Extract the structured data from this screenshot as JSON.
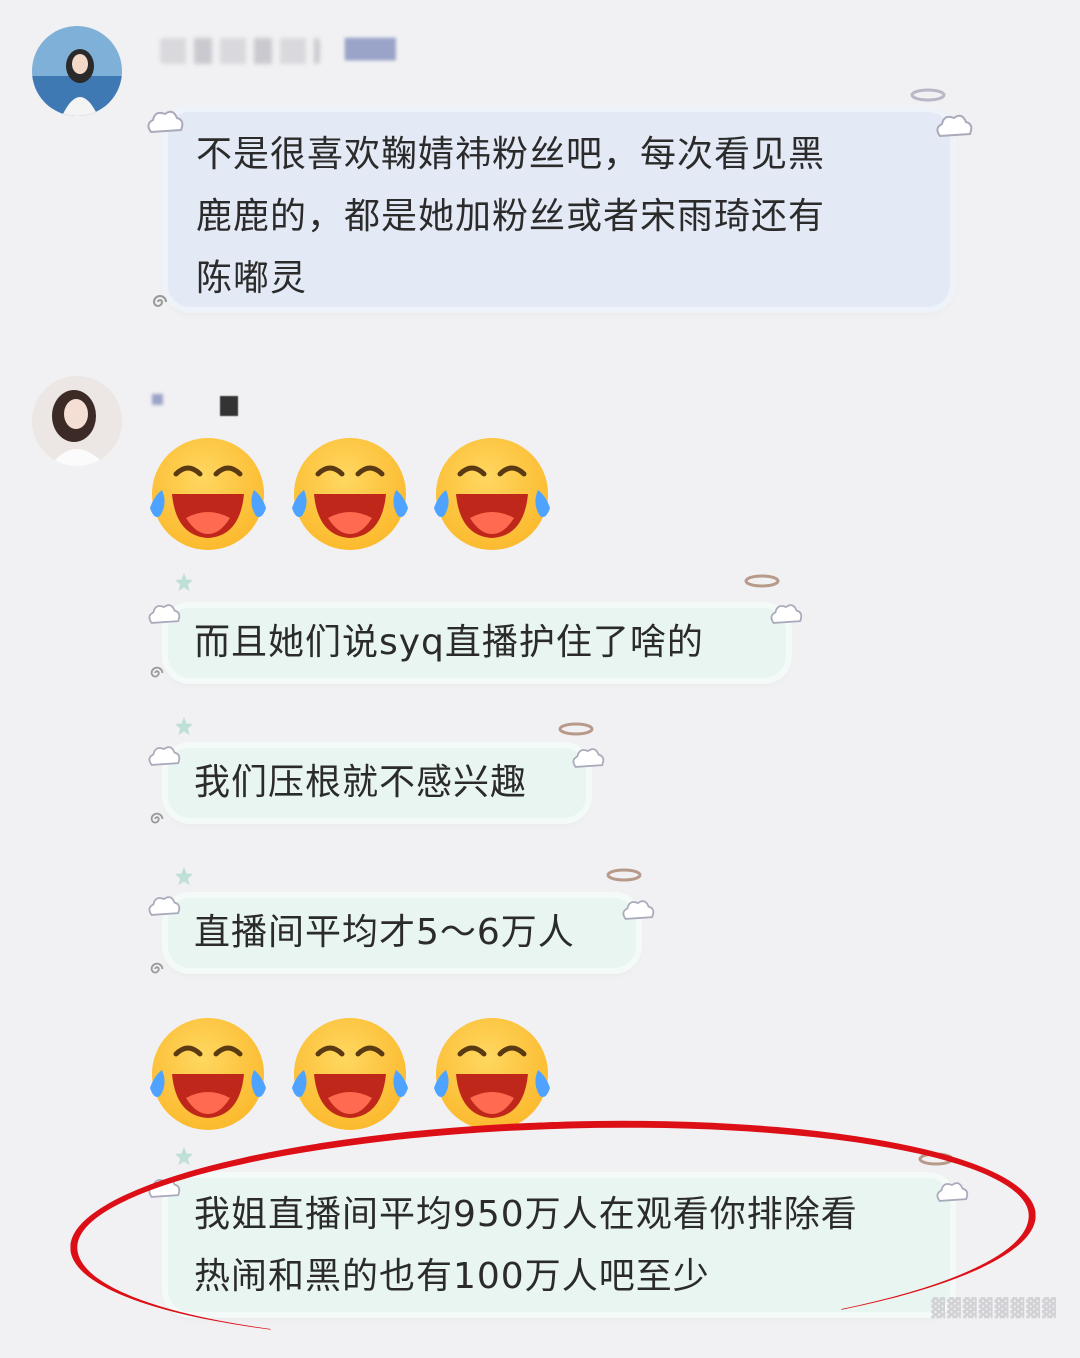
{
  "messages": [
    {
      "sender": "user-1",
      "type": "text",
      "text_lines": [
        "不是很喜欢鞠婧祎粉丝吧，每次看见黑",
        "鹿鹿的，都是她加粉丝或者宋雨琦还有",
        "陈嘟灵"
      ]
    },
    {
      "sender": "user-2",
      "type": "emoji",
      "emoji": "laughing-crying-emoji",
      "count": 3
    },
    {
      "sender": "user-2",
      "type": "text",
      "text": "而且她们说syq直播护住了啥的"
    },
    {
      "sender": "user-2",
      "type": "text",
      "text": "我们压根就不感兴趣"
    },
    {
      "sender": "user-2",
      "type": "text",
      "text": "直播间平均才5～6万人"
    },
    {
      "sender": "user-2",
      "type": "emoji",
      "emoji": "laughing-crying-emoji",
      "count": 3
    },
    {
      "sender": "user-2",
      "type": "text",
      "highlighted": true,
      "text_lines": [
        "我姐直播间平均950万人在观看你排除看",
        "热闹和黑的也有100万人吧至少"
      ]
    }
  ],
  "colors": {
    "bubble_blue": "#e3e9f5",
    "bubble_mint": "#e9f5f1",
    "highlight_circle": "#dd0f16",
    "background": "#f1f1f3"
  }
}
